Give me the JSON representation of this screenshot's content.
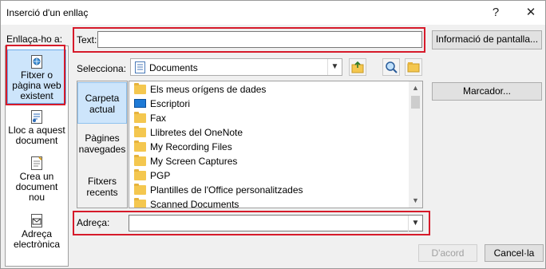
{
  "window": {
    "title": "Inserció d'un enllaç",
    "help_glyph": "?",
    "close_glyph": "✕"
  },
  "link_to": {
    "label": "Enllaça-ho a:",
    "places": [
      {
        "label": "Fitxer o pàgina web existent",
        "icon": "web-page-icon",
        "selected": true
      },
      {
        "label": "Lloc a aquest document",
        "icon": "place-in-document-icon",
        "selected": false
      },
      {
        "label": "Crea un document nou",
        "icon": "new-document-icon",
        "selected": false
      },
      {
        "label": "Adreça electrònica",
        "icon": "email-icon",
        "selected": false
      }
    ]
  },
  "text_to_display": {
    "label": "Text:",
    "value": ""
  },
  "screentip_button": "Informació de pantalla...",
  "look_in": {
    "label": "Selecciona:",
    "value": "Documents",
    "icons": [
      "up-folder-icon",
      "browse-web-icon",
      "browse-file-icon"
    ]
  },
  "bookmark_button": "Marcador...",
  "folder_tabs": [
    {
      "label": "Carpeta actual",
      "selected": true
    },
    {
      "label": "Pàgines navegades",
      "selected": false
    },
    {
      "label": "Fitxers recents",
      "selected": false
    }
  ],
  "files": [
    {
      "name": "Els meus orígens de dades",
      "type": "folder"
    },
    {
      "name": "Escriptori",
      "type": "desktop"
    },
    {
      "name": "Fax",
      "type": "folder"
    },
    {
      "name": "Llibretes del OneNote",
      "type": "folder"
    },
    {
      "name": "My Recording Files",
      "type": "folder"
    },
    {
      "name": "My Screen Captures",
      "type": "folder"
    },
    {
      "name": "PGP",
      "type": "folder"
    },
    {
      "name": "Plantilles de l'Office personalitzades",
      "type": "folder"
    },
    {
      "name": "Scanned Documents",
      "type": "folder"
    }
  ],
  "address": {
    "label": "Adreça:",
    "value": ""
  },
  "ok_button": "D'acord",
  "cancel_button": "Cancel·la",
  "colors": {
    "highlight_red": "#d61a2a",
    "selection_blue": "#cde5fb",
    "folder_yellow": "#f4c74f"
  }
}
